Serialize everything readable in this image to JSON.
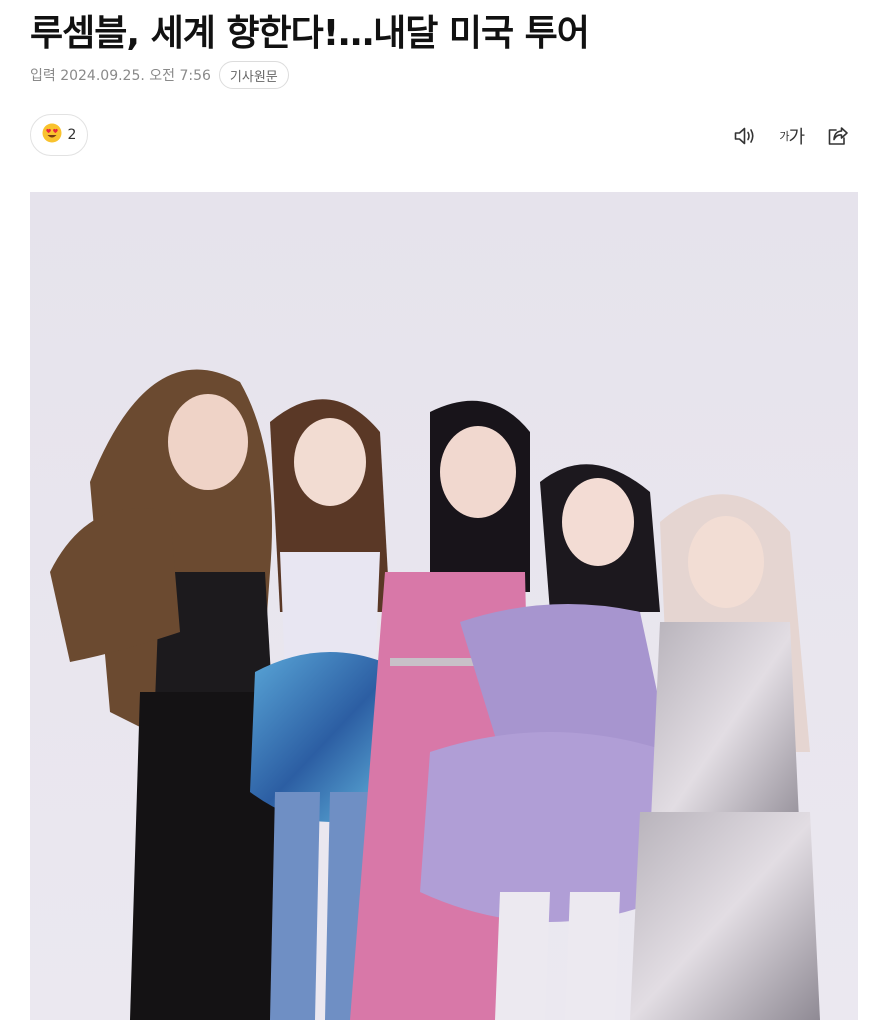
{
  "article": {
    "headline": "루셈블, 세계 향한다!…내달 미국 투어",
    "published": "입력 2024.09.25. 오전 7:56",
    "source_button": "기사원문"
  },
  "reactions": {
    "emoji_icon": "heart-eyes-emoji-icon",
    "count": "2"
  },
  "tools": {
    "audio_icon": "speaker-icon",
    "font_size_small": "가",
    "font_size_large": "가",
    "share_icon": "share-icon"
  },
  "photo": {
    "description_icon": "group-photo"
  },
  "colors": {
    "emoji": "#f9c22e",
    "background": "#ffffff"
  }
}
